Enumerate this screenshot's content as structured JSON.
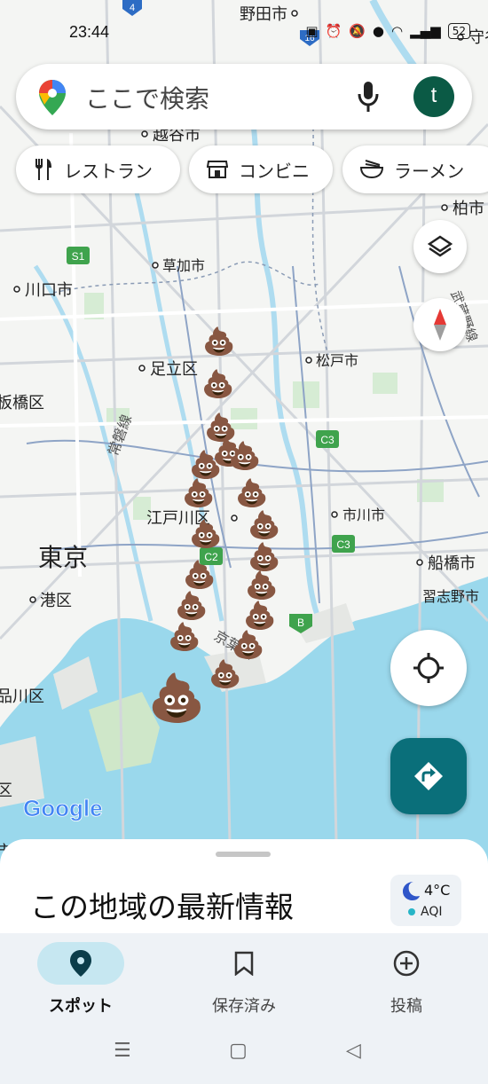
{
  "status": {
    "time": "23:44",
    "battery": "52"
  },
  "search": {
    "placeholder": "ここで検索",
    "avatar_letter": "t"
  },
  "chips": [
    {
      "label": "レストラン"
    },
    {
      "label": "コンビニ"
    },
    {
      "label": "ラーメン"
    }
  ],
  "map_labels": {
    "noda": "野田市",
    "koshigaya": "越谷市",
    "kashiwa": "柏市",
    "soka": "草加市",
    "kawaguchi": "川口市",
    "adachi": "足立区",
    "matsudo": "松戸市",
    "itabashi": "板橋区",
    "edogawa": "江戸川区",
    "ichikawa": "市川市",
    "tokyo": "東京",
    "funabashi": "船橋市",
    "minato": "港区",
    "narashino": "習志野市",
    "shinagawa": "品川区",
    "ku": "区",
    "joban": "常磐線",
    "keiyo": "京葉線",
    "musashino": "武蔵野線",
    "shi": "市",
    "moriya": "守谷",
    "shields": {
      "s1": "S1",
      "c3a": "C3",
      "c3b": "C3",
      "c2": "C2",
      "b": "B",
      "r4": "4",
      "r16": "16"
    }
  },
  "google_logo": "Google",
  "sheet": {
    "title": "この地域の最新情報"
  },
  "weather": {
    "temp": "4°C",
    "aqi": "AQI"
  },
  "nav": {
    "spot": "スポット",
    "saved": "保存済み",
    "post": "投稿"
  },
  "colors": {
    "water": "#9ad8ec",
    "land": "#f4f5f3",
    "accent": "#0a6f7a",
    "nav_active": "#c6e7f1",
    "avatar": "#0b5a45"
  },
  "emoji": "💩"
}
